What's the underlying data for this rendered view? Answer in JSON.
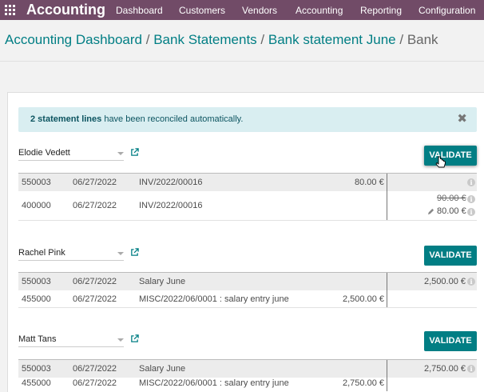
{
  "navbar": {
    "app_title": "Accounting",
    "menu": [
      "Dashboard",
      "Customers",
      "Vendors",
      "Accounting",
      "Reporting",
      "Configuration"
    ]
  },
  "breadcrumb": {
    "items": [
      "Accounting Dashboard",
      "Bank Statements",
      "Bank statement June"
    ],
    "separator": "/",
    "current": "Bank"
  },
  "notification": {
    "count_text": "2 statement lines",
    "text": " have been reconciled automatically.",
    "close": "✖"
  },
  "validate_label": "VALIDATE",
  "statements": [
    {
      "partner": "Elodie Vedett",
      "lines": [
        {
          "account": "550003",
          "date": "06/27/2022",
          "label": "INV/2022/00016",
          "debit": "80.00 €",
          "credit": ""
        },
        {
          "account": "400000",
          "date": "06/27/2022",
          "label": "INV/2022/00016",
          "debit": "",
          "credit_old": "90.00 €",
          "credit": "80.00 €"
        }
      ]
    },
    {
      "partner": "Rachel Pink",
      "lines": [
        {
          "account": "550003",
          "date": "06/27/2022",
          "label": "Salary June",
          "debit": "",
          "credit": "2,500.00 €"
        },
        {
          "account": "455000",
          "date": "06/27/2022",
          "label": "MISC/2022/06/0001 : salary entry june",
          "debit": "2,500.00 €",
          "credit": ""
        }
      ]
    },
    {
      "partner": "Matt Tans",
      "lines": [
        {
          "account": "550003",
          "date": "06/27/2022",
          "label": "Salary June",
          "debit": "",
          "credit": "2,750.00 €"
        },
        {
          "account": "455000",
          "date": "06/27/2022",
          "label": "MISC/2022/06/0001 : salary entry june",
          "debit": "2,750.00 €",
          "credit": ""
        }
      ]
    }
  ],
  "colors": {
    "brand": "#714b67",
    "accent": "#017e84",
    "notification_bg": "#d9eef1"
  }
}
